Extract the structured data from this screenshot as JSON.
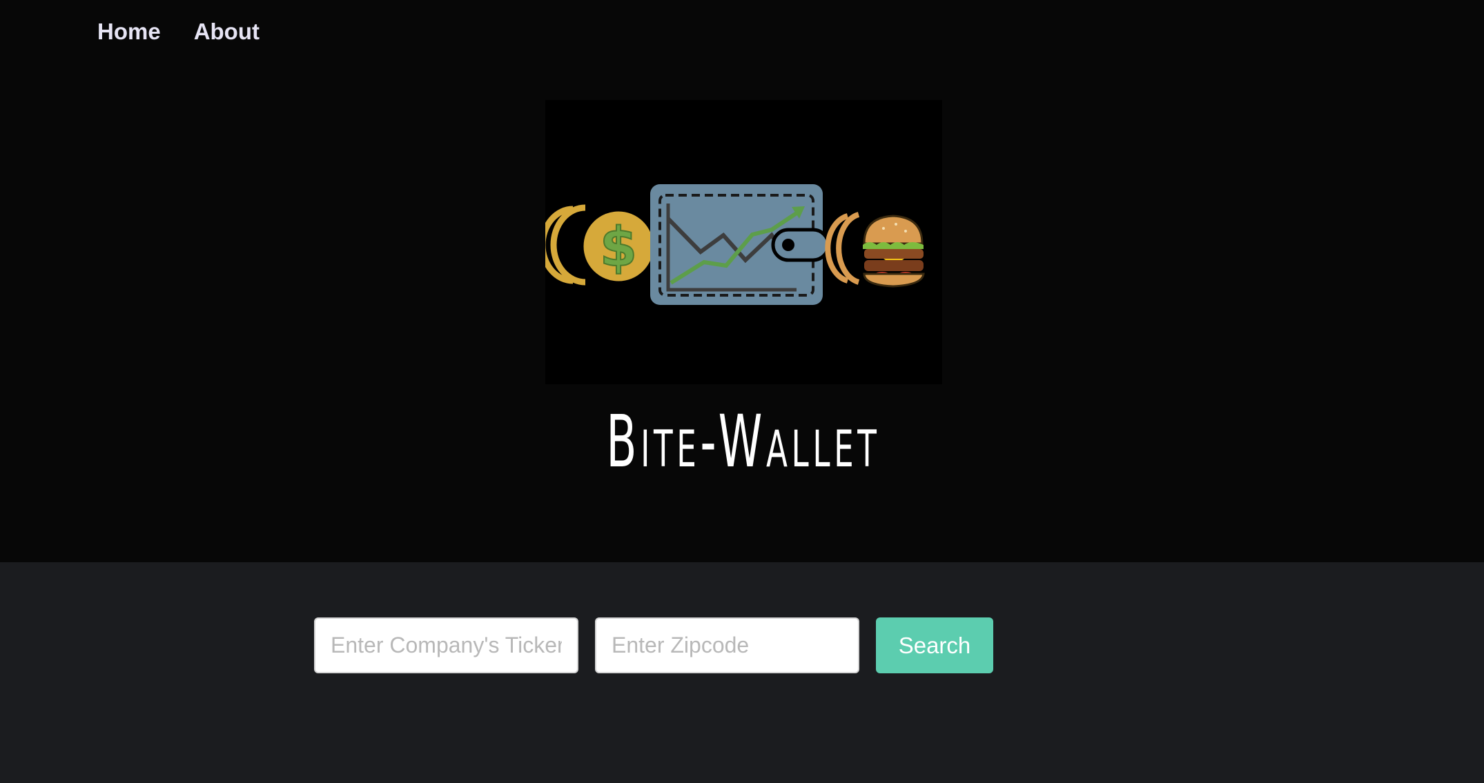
{
  "nav": {
    "items": [
      {
        "label": "Home"
      },
      {
        "label": "About"
      }
    ]
  },
  "brand": {
    "title": "Bite-Wallet"
  },
  "logo": {
    "icons": [
      "coin-dollar-icon",
      "wallet-chart-icon",
      "hamburger-icon"
    ],
    "colors": {
      "coin": "#d6a93a",
      "dollar": "#6ea645",
      "wallet": "#6a8aa0",
      "chart_up": "#5d9e4a",
      "chart_down": "#3d3d3d",
      "bun": "#d99b50"
    }
  },
  "search": {
    "ticker_placeholder": "Enter Company's Ticker",
    "zipcode_placeholder": "Enter Zipcode",
    "button_label": "Search"
  },
  "colors": {
    "hero_bg": "#070707",
    "page_bg": "#1b1c1f",
    "nav_text": "#e6e4f4",
    "button_bg": "#5ccdaf"
  }
}
